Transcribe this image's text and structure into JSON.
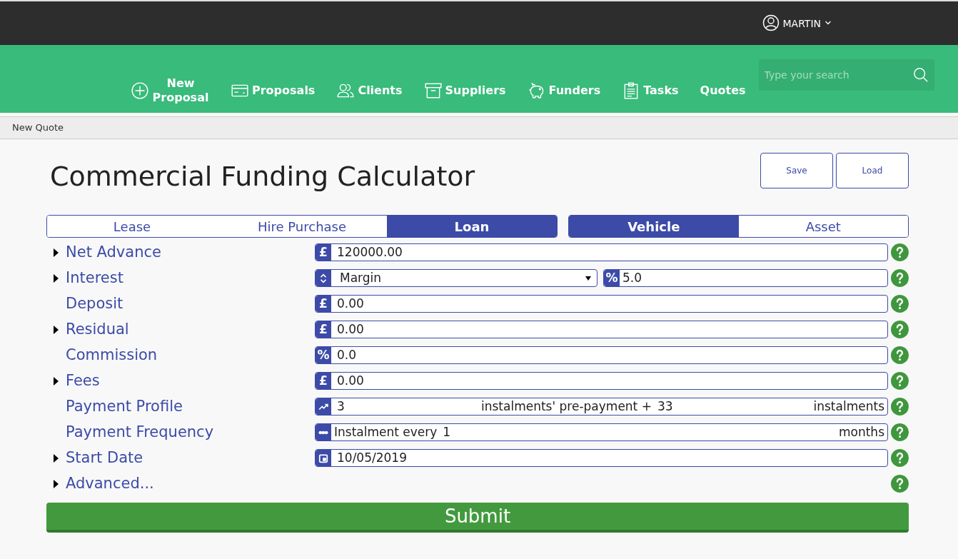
{
  "user_menu": {
    "name": "MARTIN"
  },
  "nav": [
    {
      "label": "New Proposal",
      "kind": "plus"
    },
    {
      "label": "Proposals",
      "kind": "card"
    },
    {
      "label": "Clients",
      "kind": "users"
    },
    {
      "label": "Suppliers",
      "kind": "box"
    },
    {
      "label": "Funders",
      "kind": "piggy"
    },
    {
      "label": "Tasks",
      "kind": "clipboard"
    },
    {
      "label": "Quotes",
      "kind": "none"
    }
  ],
  "search": {
    "placeholder": "Type your search"
  },
  "breadcrumb": "New Quote",
  "title": "Commercial Funding Calculator",
  "actions": [
    "Save",
    "Load"
  ],
  "product_tabs": [
    {
      "label": "Lease",
      "selected": false
    },
    {
      "label": "Hire Purchase",
      "selected": false
    },
    {
      "label": "Loan",
      "selected": true
    }
  ],
  "type_tabs": [
    {
      "label": "Vehicle",
      "selected": true
    },
    {
      "label": "Asset",
      "selected": false
    }
  ],
  "rows": [
    {
      "label": "Net Advance",
      "expandable": true,
      "kind": "amount",
      "prefix": "£",
      "value": "120000.00"
    },
    {
      "label": "Interest",
      "expandable": true,
      "kind": "select_pct",
      "value": "Margin",
      "prefix": "%",
      "value2": "5.0"
    },
    {
      "label": "Deposit",
      "expandable": false,
      "kind": "amount",
      "prefix": "£",
      "value": "0.00"
    },
    {
      "label": "Residual",
      "expandable": true,
      "kind": "amount",
      "prefix": "£",
      "value": "0.00"
    },
    {
      "label": "Commission",
      "expandable": false,
      "kind": "amount",
      "prefix": "%",
      "value": "0.0"
    },
    {
      "label": "Fees",
      "expandable": true,
      "kind": "amount",
      "prefix": "£",
      "value": "0.00"
    },
    {
      "label": "Payment Profile",
      "expandable": false,
      "kind": "profile",
      "value": "3",
      "middle": "instalments' pre-payment +",
      "value2": "33",
      "suffix": "instalments"
    },
    {
      "label": "Payment Frequency",
      "expandable": false,
      "kind": "frequency",
      "middle": "Instalment every",
      "value": "1",
      "suffix": "months"
    },
    {
      "label": "Start Date",
      "expandable": true,
      "kind": "date",
      "value": "10/05/2019"
    },
    {
      "label": "Advanced...",
      "expandable": true,
      "kind": "none"
    }
  ],
  "submit": "Submit"
}
